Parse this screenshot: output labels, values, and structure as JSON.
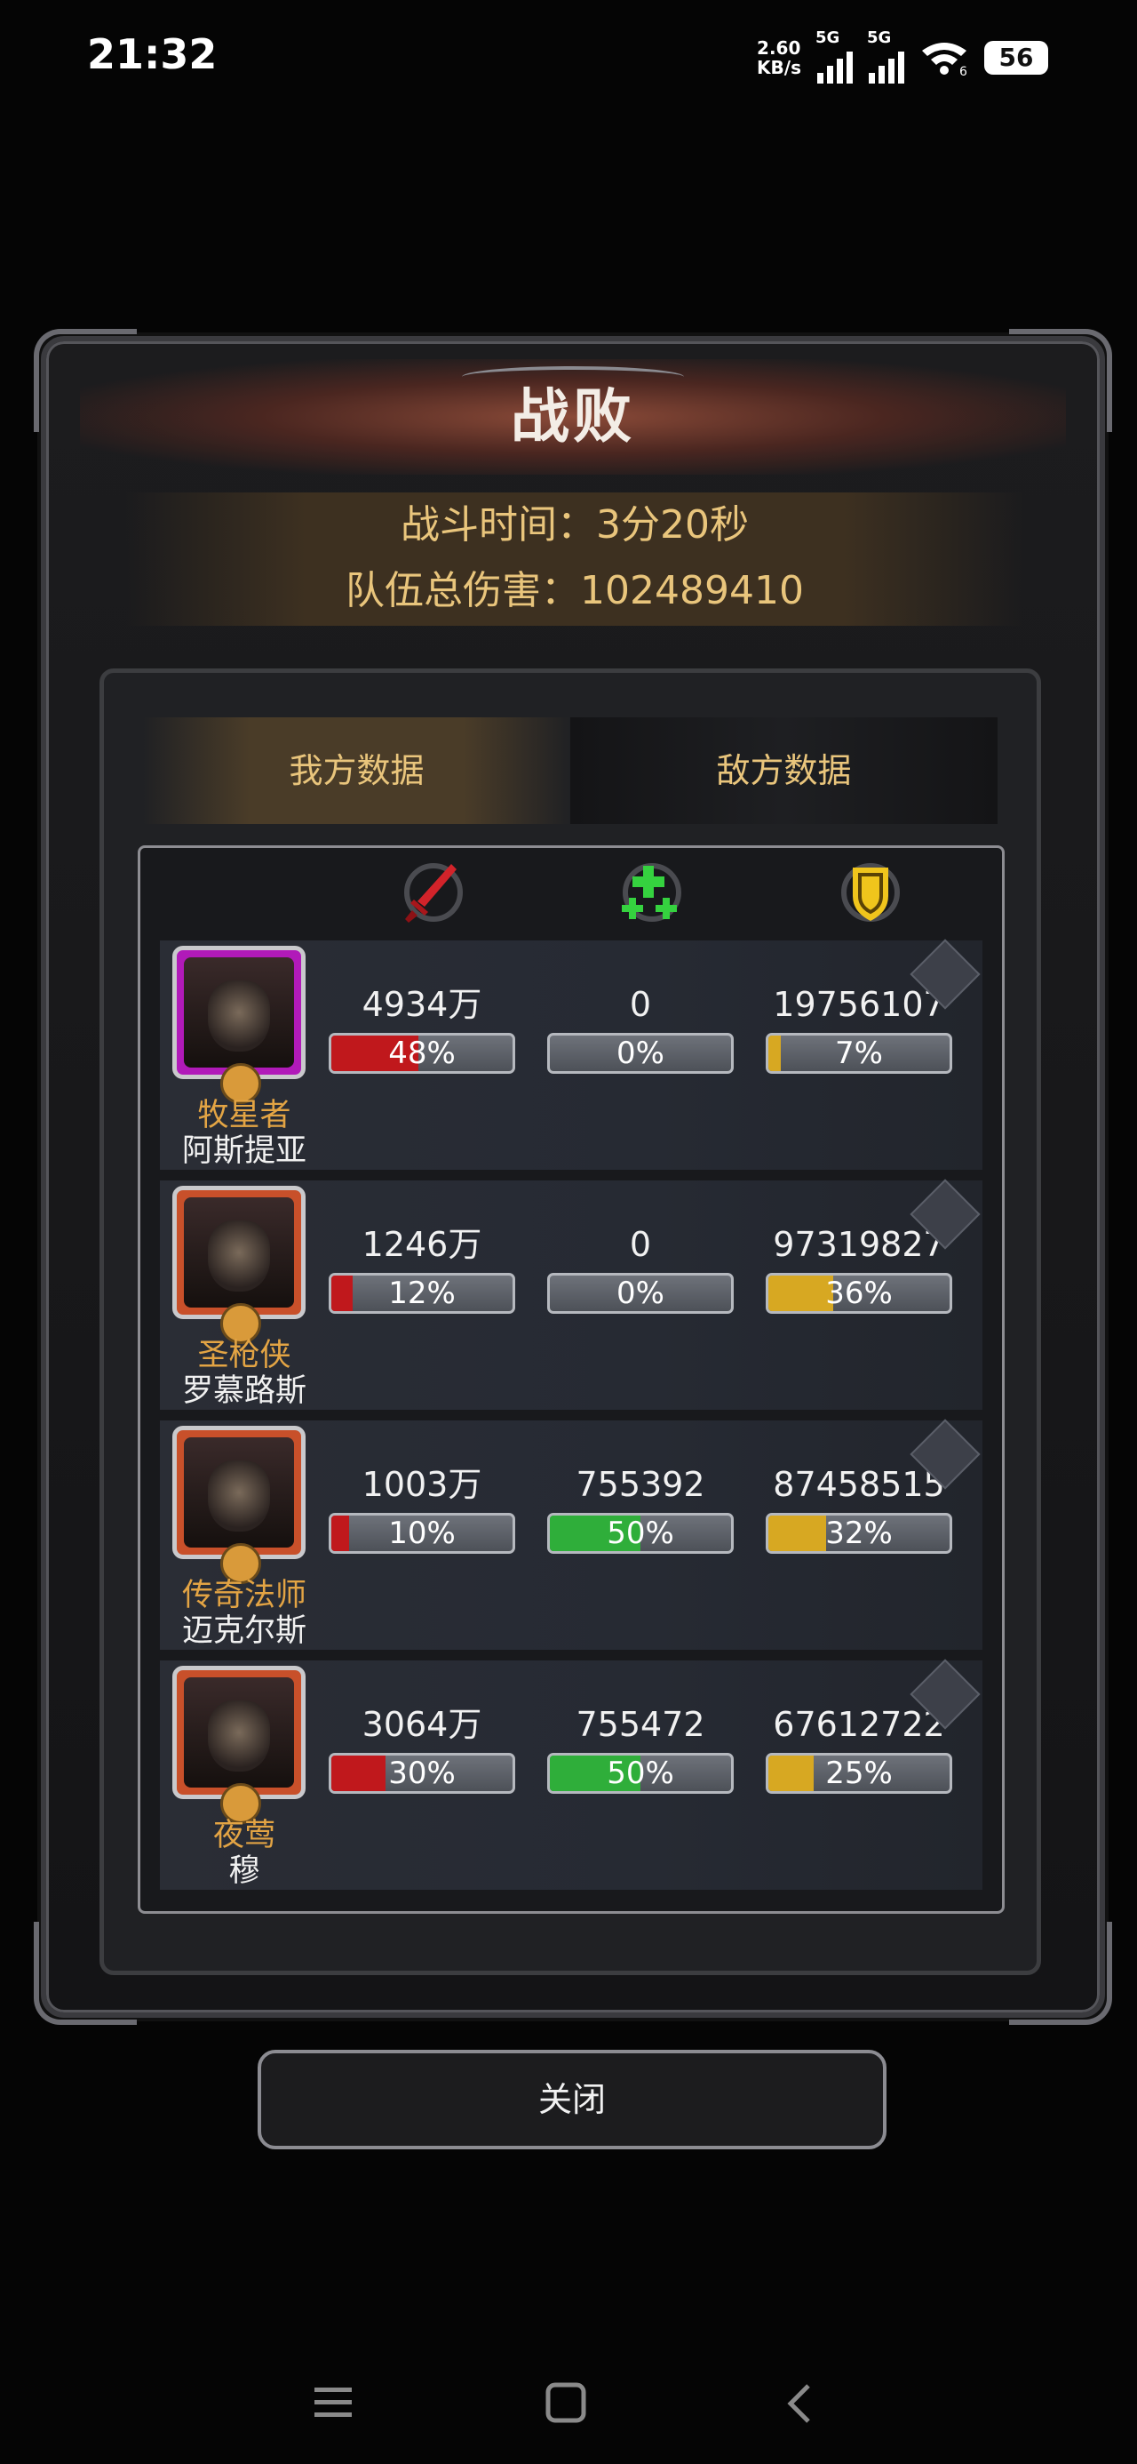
{
  "status_bar": {
    "time": "21:32",
    "speed_value": "2.60",
    "speed_unit": "KB/s",
    "sig1_label": "5G",
    "sig2_label": "5G",
    "wifi_label": "6",
    "battery": "56"
  },
  "panel": {
    "title": "战败",
    "battle_time": "战斗时间：3分20秒",
    "team_damage": "队伍总伤害：102489410",
    "tabs": [
      "我方数据",
      "敌方数据"
    ],
    "active_tab": 0
  },
  "columns": [
    "damage",
    "healing",
    "damage_taken"
  ],
  "heroes": [
    {
      "class": "牧星者",
      "name": "阿斯提亚",
      "frame_color": "#b11ab9",
      "damage": "4934万",
      "damage_pct": "48%",
      "damage_frac": 0.48,
      "heal": "0",
      "heal_pct": "0%",
      "heal_frac": 0.0,
      "tank": "19756107",
      "tank_pct": "7%",
      "tank_frac": 0.07
    },
    {
      "class": "圣枪侠",
      "name": "罗慕路斯",
      "frame_color": "#c8502a",
      "damage": "1246万",
      "damage_pct": "12%",
      "damage_frac": 0.12,
      "heal": "0",
      "heal_pct": "0%",
      "heal_frac": 0.0,
      "tank": "97319827",
      "tank_pct": "36%",
      "tank_frac": 0.36
    },
    {
      "class": "传奇法师",
      "name": "迈克尔斯",
      "frame_color": "#c8502a",
      "damage": "1003万",
      "damage_pct": "10%",
      "damage_frac": 0.1,
      "heal": "755392",
      "heal_pct": "50%",
      "heal_frac": 0.5,
      "tank": "87458515",
      "tank_pct": "32%",
      "tank_frac": 0.32
    },
    {
      "class": "夜莺",
      "name": "穆",
      "frame_color": "#c8502a",
      "damage": "3064万",
      "damage_pct": "30%",
      "damage_frac": 0.3,
      "heal": "755472",
      "heal_pct": "50%",
      "heal_frac": 0.5,
      "tank": "67612722",
      "tank_pct": "25%",
      "tank_frac": 0.25
    }
  ],
  "close_label": "关闭",
  "colors": {
    "damage_bar": "#c0181c",
    "heal_bar": "#2fae3a",
    "tank_bar": "#d7a822",
    "gold_text": "#e9c57c"
  }
}
